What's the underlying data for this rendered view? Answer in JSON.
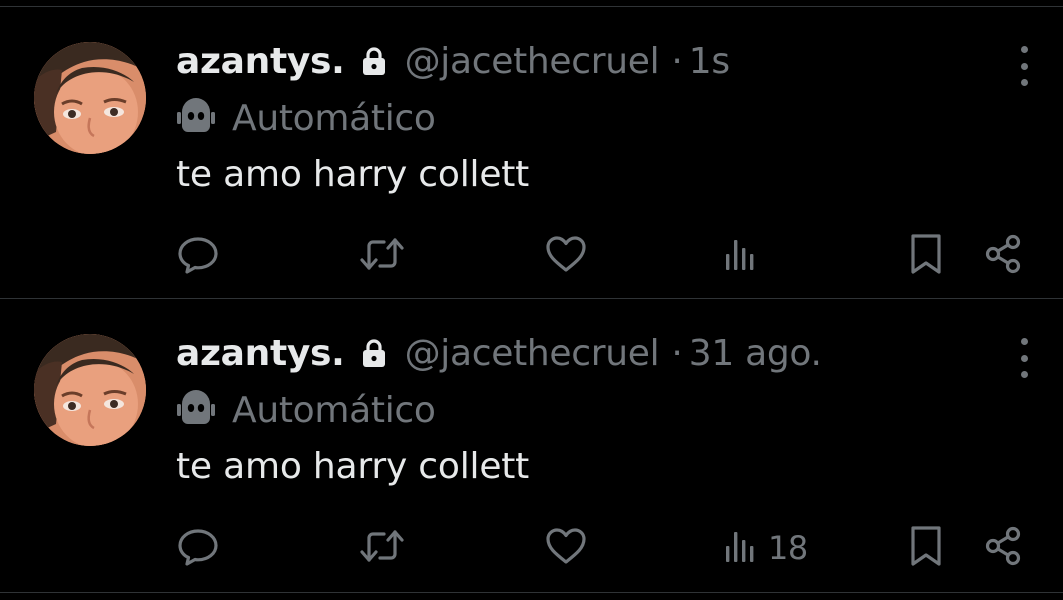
{
  "colors": {
    "background": "#000000",
    "primary_text": "#e7e9ea",
    "secondary_text": "#71767b",
    "divider": "#2f3336"
  },
  "tweets": [
    {
      "author": {
        "display_name": "azantys.",
        "handle": "@jacethecruel",
        "avatar_icon": "avatar-photo",
        "protected_icon": "lock-icon"
      },
      "time_separator": "·",
      "time": "1s",
      "automated_icon": "robot-icon",
      "automated_label": "Automático",
      "text": "te amo harry collett",
      "actions": {
        "reply_icon": "reply-icon",
        "retweet_icon": "retweet-icon",
        "like_icon": "heart-icon",
        "views_icon": "views-icon",
        "views_count": "",
        "bookmark_icon": "bookmark-icon",
        "share_icon": "share-icon"
      },
      "more_icon": "more-icon"
    },
    {
      "author": {
        "display_name": "azantys.",
        "handle": "@jacethecruel",
        "avatar_icon": "avatar-photo",
        "protected_icon": "lock-icon"
      },
      "time_separator": "·",
      "time": "31 ago.",
      "automated_icon": "robot-icon",
      "automated_label": "Automático",
      "text": "te amo harry collett",
      "actions": {
        "reply_icon": "reply-icon",
        "retweet_icon": "retweet-icon",
        "like_icon": "heart-icon",
        "views_icon": "views-icon",
        "views_count": "18",
        "bookmark_icon": "bookmark-icon",
        "share_icon": "share-icon"
      },
      "more_icon": "more-icon"
    }
  ]
}
